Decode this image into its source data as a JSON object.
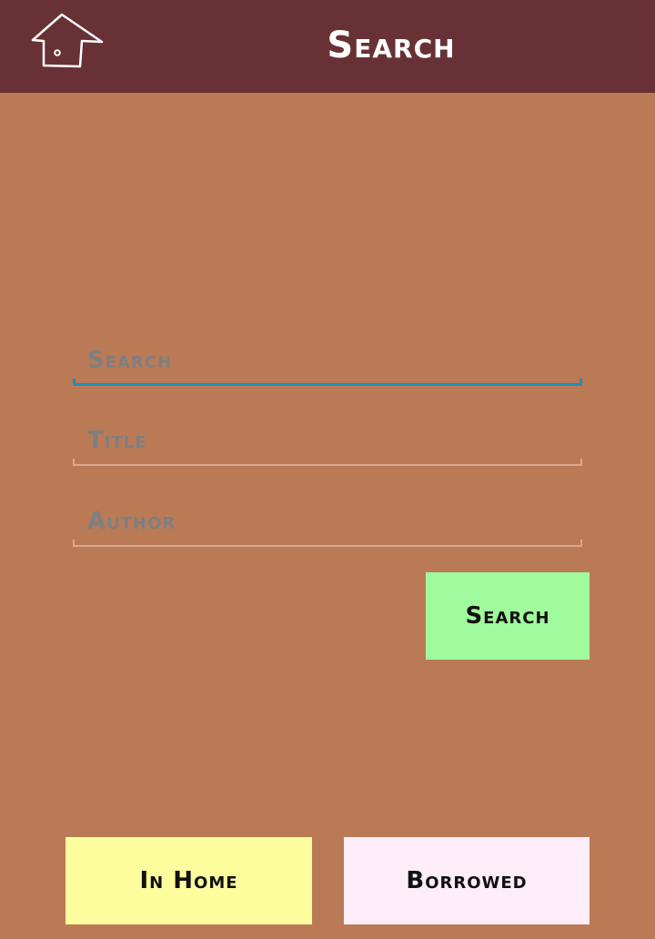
{
  "header": {
    "title": "Search",
    "home_icon": "home-icon"
  },
  "form": {
    "search_placeholder": "Search",
    "title_placeholder": "Title",
    "author_placeholder": "Author",
    "search_button_label": "Search"
  },
  "footer": {
    "in_home_label": "In Home",
    "borrowed_label": "Borrowed"
  },
  "colors": {
    "background": "#bb7a56",
    "topbar": "#673135",
    "focus_underline": "#1f8fb5",
    "search_button": "#9ffb9c",
    "in_home_button": "#fdfd9e",
    "borrowed_button": "#fdedf8"
  }
}
